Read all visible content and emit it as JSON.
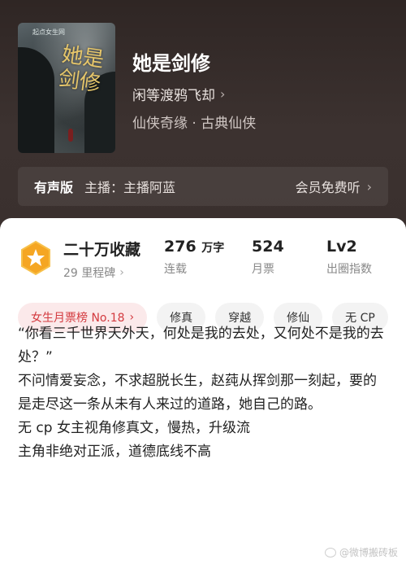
{
  "cover": {
    "publisher": "起点女生网",
    "title_art": "她是剑修"
  },
  "book": {
    "title": "她是剑修",
    "author": "闲等渡鸦飞却",
    "genres": "仙侠奇缘 · 古典仙侠"
  },
  "audio": {
    "label": "有声版",
    "anchor": "主播：主播阿蓝",
    "free": "会员免费听"
  },
  "stats": {
    "collections": "二十万收藏",
    "milestone": "29 里程碑",
    "words_value": "276",
    "words_unit": "万字",
    "status": "连载",
    "votes": "524",
    "votes_label": "月票",
    "level": "Lv2",
    "level_label": "出圈指数"
  },
  "tags": [
    "女生月票榜 No.18",
    "修真",
    "穿越",
    "修仙",
    "无 CP"
  ],
  "description": [
    "“你看三千世界天外天，何处是我的去处，又何处不是我的去处？”",
    "不问情爱妄念，不求超脱长生，赵莼从挥剑那一刻起，要的是走尽这一条从未有人来过的道路，她自己的路。",
    "无 cp 女主视角修真文，慢热，升级流",
    "主角非绝对正派，道德底线不高"
  ],
  "watermark": "@微博搬砖板",
  "colors": {
    "header_bg": "#3a302e",
    "rank_tag_text": "#d33a3f",
    "rank_tag_bg": "#fbe9ea",
    "badge": "#f5a623"
  },
  "icons": {
    "badge": "star-badge-icon",
    "chevron": "chevron-right-icon"
  }
}
